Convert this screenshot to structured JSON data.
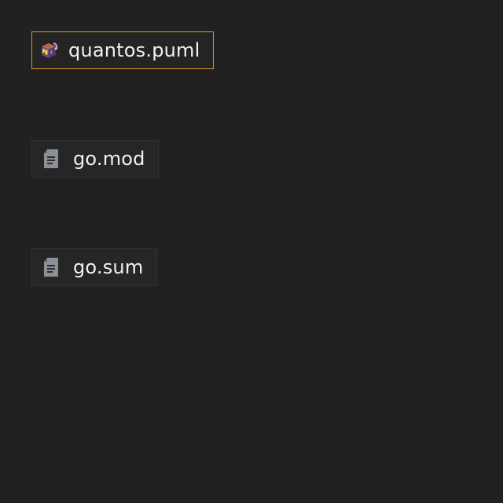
{
  "files": [
    {
      "name": "quantos.puml",
      "icon": "plantuml-file-icon",
      "selected": true
    },
    {
      "name": "go.mod",
      "icon": "text-file-icon",
      "selected": false
    },
    {
      "name": "go.sum",
      "icon": "text-file-icon",
      "selected": false
    }
  ],
  "colors": {
    "background": "#212121",
    "tile_background": "#262626",
    "tile_border": "#323232",
    "selection_border": "#d79b1f",
    "text": "#f2f2f2",
    "doc_icon": "#8a9097"
  }
}
